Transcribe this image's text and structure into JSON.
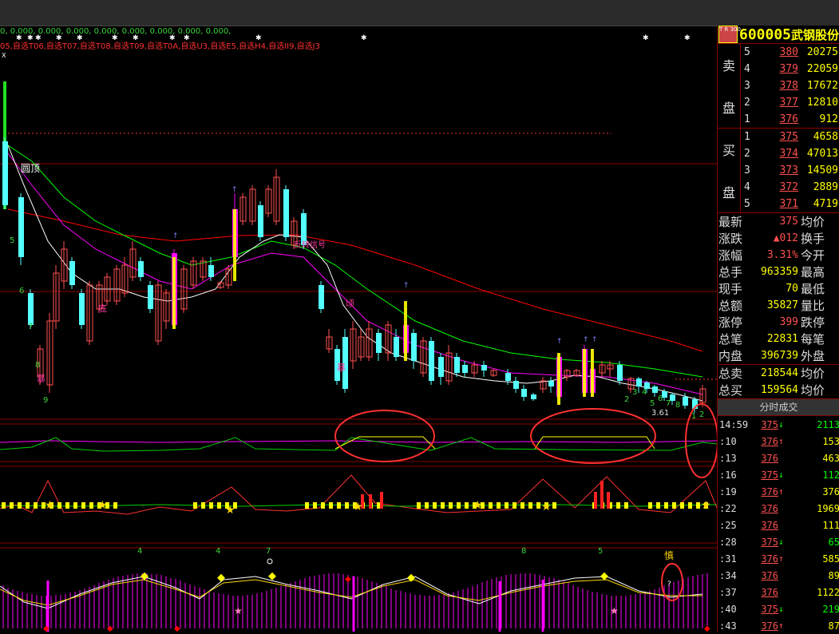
{
  "indicator_values": "0, 0.000, 0.000, 0.000, 0.000, 0.000, 0.000, 0.000, 0.000,",
  "picks_line": "05,自选T06,自选T07,自选T08,自选T09,自选T0A,自选U3,自选E5,自选H4,自选II9,自选J3",
  "chart_labels": {
    "round_top": "圆顶",
    "reverse_signal": "反转信号",
    "di_1": "底",
    "bao": "暴",
    "qing": "顷",
    "bao_2": "暴",
    "shen": "慎",
    "num_3619": "3.61",
    "x_marker": "X",
    "q_mark": "?"
  },
  "digits": {
    "d5": "5",
    "d6": "6",
    "d7": "7",
    "d8": "8",
    "d9": "9",
    "d2a": "2",
    "d3": "3",
    "d4": "4",
    "d5b": "5",
    "d6b": "6",
    "d7b": "7",
    "d8b": "8",
    "d1": "1",
    "d2b": "2"
  },
  "bottom_nums": {
    "n4a": "4",
    "n4b": "4",
    "n7": "7",
    "n8": "8",
    "n5": "5"
  },
  "ticker": {
    "badge": "T R 300",
    "code": "600005",
    "name": "武钢股份"
  },
  "sell_label": [
    "卖",
    "盘"
  ],
  "buy_label": [
    "买",
    "盘"
  ],
  "sell": [
    {
      "lv": "5",
      "price": "380",
      "vol": "20275"
    },
    {
      "lv": "4",
      "price": "379",
      "vol": "22059"
    },
    {
      "lv": "3",
      "price": "378",
      "vol": "17672"
    },
    {
      "lv": "2",
      "price": "377",
      "vol": "12810"
    },
    {
      "lv": "1",
      "price": "376",
      "vol": "912"
    }
  ],
  "buy": [
    {
      "lv": "1",
      "price": "375",
      "vol": "4658"
    },
    {
      "lv": "2",
      "price": "374",
      "vol": "47013"
    },
    {
      "lv": "3",
      "price": "373",
      "vol": "14509"
    },
    {
      "lv": "4",
      "price": "372",
      "vol": "2889"
    },
    {
      "lv": "5",
      "price": "371",
      "vol": "4719"
    }
  ],
  "stats": [
    {
      "k": "最新",
      "v": "375",
      "red": true,
      "k2": "均价"
    },
    {
      "k": "涨跌",
      "v": "▲012",
      "red": true,
      "k2": "换手"
    },
    {
      "k": "涨幅",
      "v": "3.31%",
      "red": true,
      "k2": "今开"
    },
    {
      "k": "总手",
      "v": "963359",
      "red": false,
      "k2": "最高"
    },
    {
      "k": "现手",
      "v": "70",
      "red": false,
      "k2": "最低"
    },
    {
      "k": "总额",
      "v": "35827",
      "red": false,
      "k2": "量比"
    },
    {
      "k": "涨停",
      "v": "399",
      "red": true,
      "k2": "跌停"
    },
    {
      "k": "总笔",
      "v": "22831",
      "red": false,
      "k2": "每笔"
    },
    {
      "k": "内盘",
      "v": "396739",
      "red": false,
      "k2": "外盘"
    }
  ],
  "stats2": [
    {
      "k": "总卖",
      "v": "218544",
      "red": false,
      "k2": "均价"
    },
    {
      "k": "总买",
      "v": "159564",
      "red": false,
      "k2": "均价"
    }
  ],
  "tape_title": "分时成交",
  "tape": [
    {
      "t": "14:59",
      "p": "375",
      "a": "↓",
      "dir": "dn",
      "q": "2113",
      "g": true
    },
    {
      "t": ":10",
      "p": "376",
      "a": "↑",
      "dir": "up",
      "q": "153",
      "g": false
    },
    {
      "t": ":13",
      "p": "376",
      "a": "",
      "dir": "",
      "q": "463",
      "g": false
    },
    {
      "t": ":16",
      "p": "375",
      "a": "↓",
      "dir": "dn",
      "q": "112",
      "g": true
    },
    {
      "t": ":19",
      "p": "376",
      "a": "↑",
      "dir": "up",
      "q": "376",
      "g": false
    },
    {
      "t": ":22",
      "p": "376",
      "a": "",
      "dir": "",
      "q": "1969",
      "g": false
    },
    {
      "t": ":25",
      "p": "376",
      "a": "",
      "dir": "",
      "q": "111",
      "g": false
    },
    {
      "t": ":28",
      "p": "375",
      "a": "↓",
      "dir": "dn",
      "q": "65",
      "g": true
    },
    {
      "t": ":31",
      "p": "376",
      "a": "↑",
      "dir": "up",
      "q": "585",
      "g": false
    },
    {
      "t": ":34",
      "p": "376",
      "a": "",
      "dir": "",
      "q": "89",
      "g": false
    },
    {
      "t": ":37",
      "p": "376",
      "a": "",
      "dir": "",
      "q": "1122",
      "g": false
    },
    {
      "t": ":40",
      "p": "375",
      "a": "↓",
      "dir": "dn",
      "q": "219",
      "g": true
    },
    {
      "t": ":43",
      "p": "376",
      "a": "↑",
      "dir": "up",
      "q": "87",
      "g": false
    }
  ],
  "colors": {
    "up": "#ff5050",
    "down": "#54ffff",
    "ma5": "#ffffff",
    "ma10": "#ff00ff",
    "ma20": "#00ff00",
    "ma60": "#ff0000",
    "signal": "#ffff00",
    "circle": "#ff3030"
  }
}
